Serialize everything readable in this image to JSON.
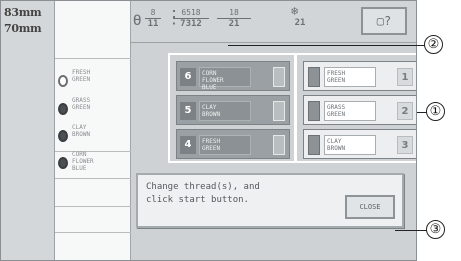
{
  "dimensions": {
    "height": "83mm",
    "width": "70mm"
  },
  "status_bar": {
    "needle_top": "8",
    "needle_bottom": "11",
    "stitch_top": "6518",
    "stitch_bottom": "7312",
    "time_top": "18",
    "time_bottom": "21",
    "time2_bottom": "21",
    "unit": "min"
  },
  "thread_list": [
    {
      "label": "FRESH\nGREEN",
      "spool": "light"
    },
    {
      "label": "GRASS\nGREEN",
      "spool": "dark"
    },
    {
      "label": "CLAY\nBROWN",
      "spool": "dark"
    },
    {
      "label": "CORN\nFLOWER\nBLUE",
      "spool": "dark"
    }
  ],
  "current_threads": [
    {
      "num": "6",
      "name": "CORN\nFLOWER\nBLUE"
    },
    {
      "num": "5",
      "name": "CLAY\nBROWN"
    },
    {
      "num": "4",
      "name": "FRESH\nGREEN"
    }
  ],
  "new_threads": [
    {
      "num": "1",
      "name": "FRESH\nGREEN"
    },
    {
      "num": "2",
      "name": "GRASS\nGREEN"
    },
    {
      "num": "3",
      "name": "CLAY\nBROWN"
    }
  ],
  "dialog": {
    "message": "Change thread(s), and\nclick start button.",
    "close_label": "CLOSE"
  },
  "callouts": {
    "one": "①",
    "two": "②",
    "three": "③"
  }
}
